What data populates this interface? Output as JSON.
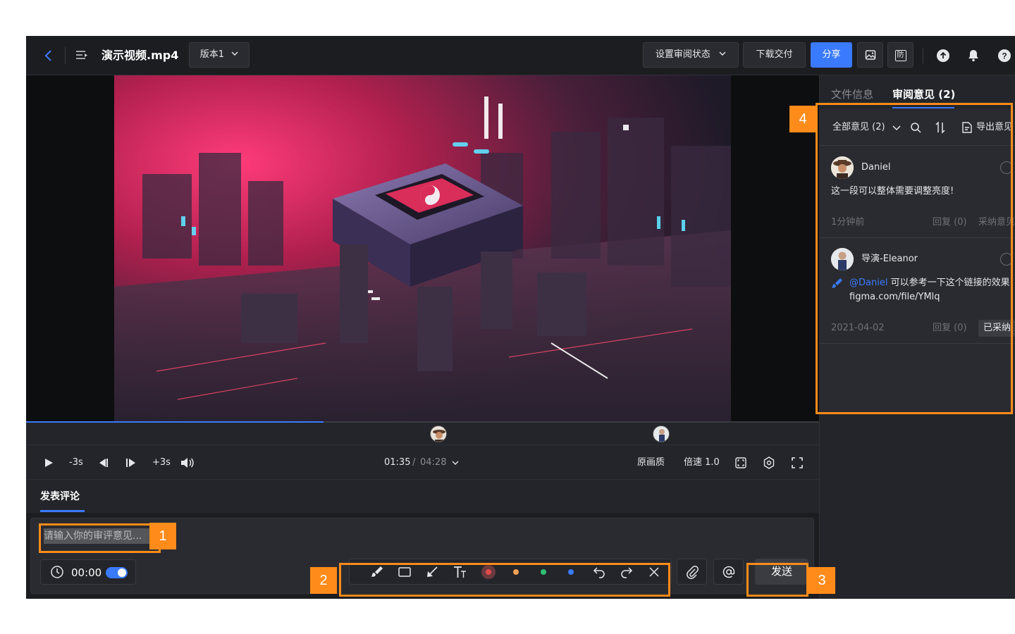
{
  "topbar": {
    "back_icon": "chevron-left-icon",
    "list_icon": "playlist-icon",
    "file_name": "演示视频.mp4",
    "version_label": "版本1",
    "review_status_label": "设置审阅状态",
    "download_label": "下载交付",
    "share_label": "分享",
    "icons": [
      "image-icon",
      "anti-leak-icon",
      "upload-icon",
      "bell-icon",
      "help-icon"
    ],
    "anti_leak_glyph": "防",
    "help_glyph": "?"
  },
  "player": {
    "progress": 0.375,
    "comment_marker_positions_fraction": [
      0.52,
      0.8
    ],
    "rewind_label": "-3s",
    "forward_label": "+3s",
    "current_time": "01:35",
    "time_separator": "/",
    "duration": "04:28",
    "quality_label": "原画质",
    "speed_label": "倍速 1.0"
  },
  "comment_composer": {
    "tab_label": "发表评论",
    "placeholder": "请输入你的审评意见...",
    "timestamp": "00:00",
    "timestamp_toggle_on": true,
    "draw_tools": [
      "brush-icon",
      "rectangle-icon",
      "arrow-icon",
      "text-icon"
    ],
    "colors": [
      "#e04a4a",
      "#f0a050",
      "#2fbf71",
      "#3a7afe"
    ],
    "send_label": "发送"
  },
  "review_panel": {
    "tab_file_info": "文件信息",
    "tab_reviews": "审阅意见 (2)",
    "filter_label": "全部意见 (2)",
    "export_label": "导出意见",
    "comments": [
      {
        "author": "Daniel",
        "text": "这一段可以整体需要调整亮度!",
        "time": "1分钟前",
        "reply": "回复 (0)",
        "action": "采纳意见"
      },
      {
        "author": "导演-Eleanor",
        "mention": "@Daniel",
        "text": "可以参考一下这个链接的效果",
        "link": "figma.com/file/YMlq",
        "time": "2021-04-02",
        "reply": "回复 (0)",
        "action": "已采纳"
      }
    ]
  },
  "callouts": [
    "1",
    "2",
    "3",
    "4"
  ],
  "colors": {
    "accent": "#3a7afe",
    "callout": "#ff8c1a",
    "background": "#24252a"
  }
}
